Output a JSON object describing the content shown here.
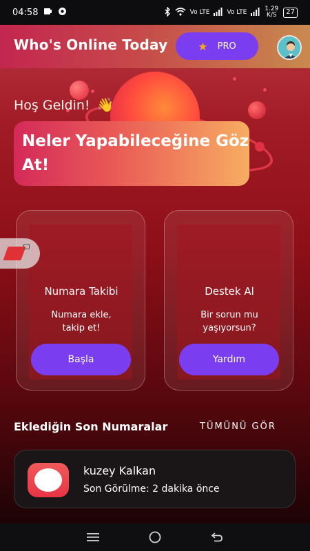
{
  "status_bar": {
    "time": "04:58",
    "network_1": "Vo LTE",
    "network_2": "Vo LTE",
    "speed": "1.29 K/S",
    "battery": "27"
  },
  "header": {
    "title": "Who's Online Today",
    "pro_label": "PRO"
  },
  "welcome": {
    "greeting": "Hoş Geldin!",
    "wave_emoji": "👋",
    "headline": "Neler Yapabileceğine Göz At!"
  },
  "cards": [
    {
      "title": "Numara Takibi",
      "description": "Numara ekle, takip et!",
      "button": "Başla"
    },
    {
      "title": "Destek Al",
      "description": "Bir sorun mu yaşıyorsun?",
      "button": "Yardım"
    }
  ],
  "recent": {
    "section_title": "Eklediğin Son Numaralar",
    "see_all": "TÜMÜNÜ GÖR",
    "items": [
      {
        "name": "kuzey Kalkan",
        "last_seen": "Son Görülme: 2 dakika önce"
      }
    ]
  },
  "colors": {
    "accent": "#7b3df0",
    "star": "#f6a623",
    "background_red": "#a11b25"
  }
}
